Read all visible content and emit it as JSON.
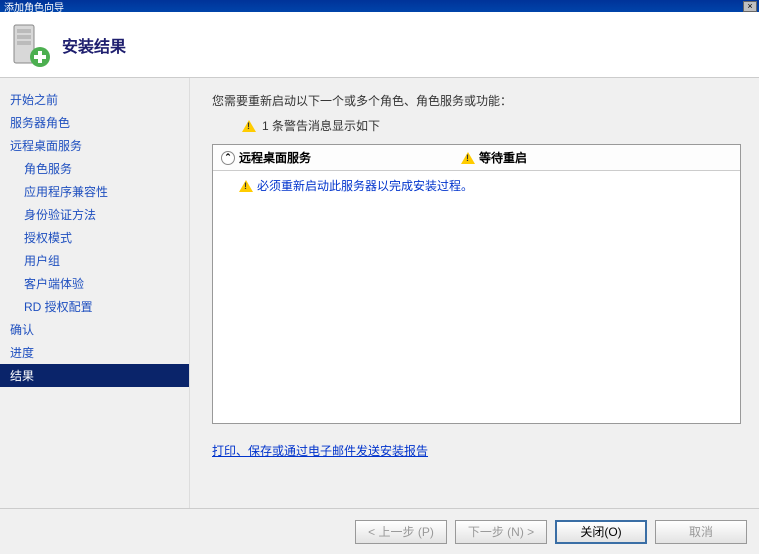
{
  "window": {
    "title": "添加角色向导",
    "close_glyph": "×"
  },
  "header": {
    "title": "安装结果"
  },
  "sidebar": {
    "items": [
      {
        "label": "开始之前",
        "indent": false
      },
      {
        "label": "服务器角色",
        "indent": false
      },
      {
        "label": "远程桌面服务",
        "indent": false
      },
      {
        "label": "角色服务",
        "indent": true
      },
      {
        "label": "应用程序兼容性",
        "indent": true
      },
      {
        "label": "身份验证方法",
        "indent": true
      },
      {
        "label": "授权模式",
        "indent": true
      },
      {
        "label": "用户组",
        "indent": true
      },
      {
        "label": "客户端体验",
        "indent": true
      },
      {
        "label": "RD 授权配置",
        "indent": true
      },
      {
        "label": "确认",
        "indent": false
      },
      {
        "label": "进度",
        "indent": false
      },
      {
        "label": "结果",
        "indent": false,
        "selected": true
      }
    ]
  },
  "content": {
    "intro": "您需要重新启动以下一个或多个角色、角色服务或功能：",
    "warning_count": "1 条警告消息显示如下",
    "result": {
      "col1": "远程桌面服务",
      "col2": "等待重启",
      "message": "必须重新启动此服务器以完成安装过程。"
    },
    "print_link": "打印、保存或通过电子邮件发送安装报告"
  },
  "footer": {
    "back": "< 上一步 (P)",
    "next": "下一步 (N) >",
    "close": "关闭(O)",
    "cancel": "取消"
  },
  "icons": {
    "collapse_arrow": "⌃"
  }
}
